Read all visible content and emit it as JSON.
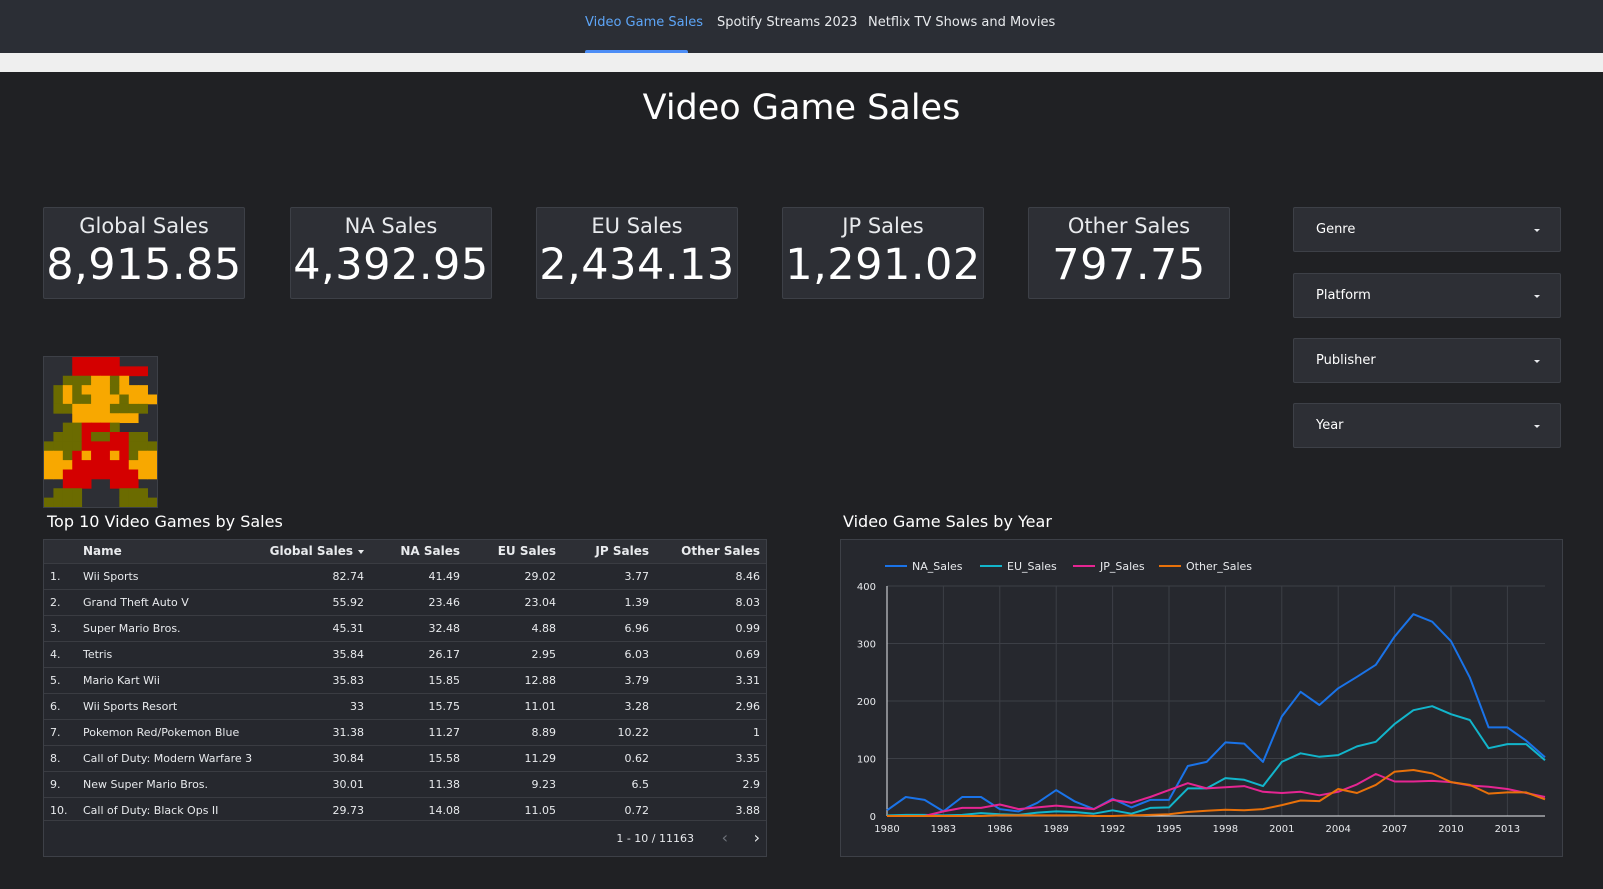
{
  "nav": {
    "tabs": [
      {
        "label": "Video Game Sales",
        "active": true
      },
      {
        "label": "Spotify Streams 2023",
        "active": false
      },
      {
        "label": "Netflix TV Shows and Movies",
        "active": false
      }
    ]
  },
  "page_title": "Video Game Sales",
  "kpis": [
    {
      "label": "Global Sales",
      "value": "8,915.85"
    },
    {
      "label": "NA Sales",
      "value": "4,392.95"
    },
    {
      "label": "EU Sales",
      "value": "2,434.13"
    },
    {
      "label": "JP Sales",
      "value": "1,291.02"
    },
    {
      "label": "Other Sales",
      "value": "797.75"
    }
  ],
  "filters": [
    "Genre",
    "Platform",
    "Publisher",
    "Year"
  ],
  "table": {
    "title": "Top 10 Video Games by Sales",
    "columns": [
      "Name",
      "Global Sales",
      "NA Sales",
      "EU Sales",
      "JP Sales",
      "Other Sales"
    ],
    "rows": [
      {
        "rank": "1.",
        "name": "Wii Sports",
        "global": "82.74",
        "na": "41.49",
        "eu": "29.02",
        "jp": "3.77",
        "other": "8.46"
      },
      {
        "rank": "2.",
        "name": "Grand Theft Auto V",
        "global": "55.92",
        "na": "23.46",
        "eu": "23.04",
        "jp": "1.39",
        "other": "8.03"
      },
      {
        "rank": "3.",
        "name": "Super Mario Bros.",
        "global": "45.31",
        "na": "32.48",
        "eu": "4.88",
        "jp": "6.96",
        "other": "0.99"
      },
      {
        "rank": "4.",
        "name": "Tetris",
        "global": "35.84",
        "na": "26.17",
        "eu": "2.95",
        "jp": "6.03",
        "other": "0.69"
      },
      {
        "rank": "5.",
        "name": "Mario Kart Wii",
        "global": "35.83",
        "na": "15.85",
        "eu": "12.88",
        "jp": "3.79",
        "other": "3.31"
      },
      {
        "rank": "6.",
        "name": "Wii Sports Resort",
        "global": "33",
        "na": "15.75",
        "eu": "11.01",
        "jp": "3.28",
        "other": "2.96"
      },
      {
        "rank": "7.",
        "name": "Pokemon Red/Pokemon Blue",
        "global": "31.38",
        "na": "11.27",
        "eu": "8.89",
        "jp": "10.22",
        "other": "1"
      },
      {
        "rank": "8.",
        "name": "Call of Duty: Modern Warfare 3",
        "global": "30.84",
        "na": "15.58",
        "eu": "11.29",
        "jp": "0.62",
        "other": "3.35"
      },
      {
        "rank": "9.",
        "name": "New Super Mario Bros.",
        "global": "30.01",
        "na": "11.38",
        "eu": "9.23",
        "jp": "6.5",
        "other": "2.9"
      },
      {
        "rank": "10.",
        "name": "Call of Duty: Black Ops II",
        "global": "29.73",
        "na": "14.08",
        "eu": "11.05",
        "jp": "0.72",
        "other": "3.88"
      }
    ],
    "pagination": "1 - 10 / 11163"
  },
  "chart_title": "Video Game Sales by Year",
  "chart_data": {
    "type": "line",
    "title": "Video Game Sales by Year",
    "x": [
      1980,
      1981,
      1982,
      1983,
      1984,
      1985,
      1986,
      1987,
      1988,
      1989,
      1990,
      1991,
      1992,
      1993,
      1994,
      1995,
      1996,
      1997,
      1998,
      1999,
      2000,
      2001,
      2002,
      2003,
      2004,
      2005,
      2006,
      2007,
      2008,
      2009,
      2010,
      2011,
      2012,
      2013,
      2014,
      2015
    ],
    "x_ticks": [
      "1980",
      "1983",
      "1986",
      "1989",
      "1992",
      "1995",
      "1998",
      "2001",
      "2004",
      "2007",
      "2010",
      "2013"
    ],
    "y_ticks": [
      "0",
      "100",
      "200",
      "300",
      "400"
    ],
    "ylim": [
      0,
      400
    ],
    "legend_position": "top-left",
    "grid": true,
    "series": [
      {
        "name": "NA_Sales",
        "color": "#1a73e8",
        "values": [
          10,
          33,
          28,
          8,
          33,
          33,
          12,
          8,
          23,
          45,
          25,
          12,
          30,
          15,
          28,
          28,
          87,
          94,
          128,
          126,
          94,
          173,
          216,
          193,
          222,
          242,
          263,
          312,
          351,
          338,
          304,
          241,
          154,
          154,
          131,
          102
        ]
      },
      {
        "name": "EU_Sales",
        "color": "#12b5cb",
        "values": [
          1,
          2,
          2,
          1,
          2,
          5,
          3,
          2,
          6,
          8,
          7,
          4,
          10,
          4,
          14,
          15,
          48,
          48,
          66,
          63,
          52,
          94,
          109,
          103,
          106,
          121,
          129,
          160,
          184,
          191,
          177,
          167,
          118,
          125,
          125,
          97
        ]
      },
      {
        "name": "JP_Sales",
        "color": "#e52592",
        "values": [
          0,
          0,
          0,
          8,
          14,
          14,
          20,
          12,
          15,
          18,
          15,
          12,
          28,
          23,
          33,
          45,
          57,
          48,
          50,
          52,
          42,
          40,
          42,
          36,
          42,
          55,
          73,
          60,
          60,
          61,
          59,
          53,
          51,
          47,
          40,
          33
        ]
      },
      {
        "name": "Other_Sales",
        "color": "#e8710a",
        "values": [
          0,
          0,
          0,
          0,
          0,
          0,
          1,
          1,
          1,
          1,
          1,
          0,
          0,
          1,
          2,
          3,
          7,
          9,
          11,
          10,
          12,
          19,
          27,
          26,
          47,
          40,
          54,
          77,
          80,
          74,
          59,
          54,
          39,
          41,
          41,
          29
        ]
      }
    ]
  }
}
